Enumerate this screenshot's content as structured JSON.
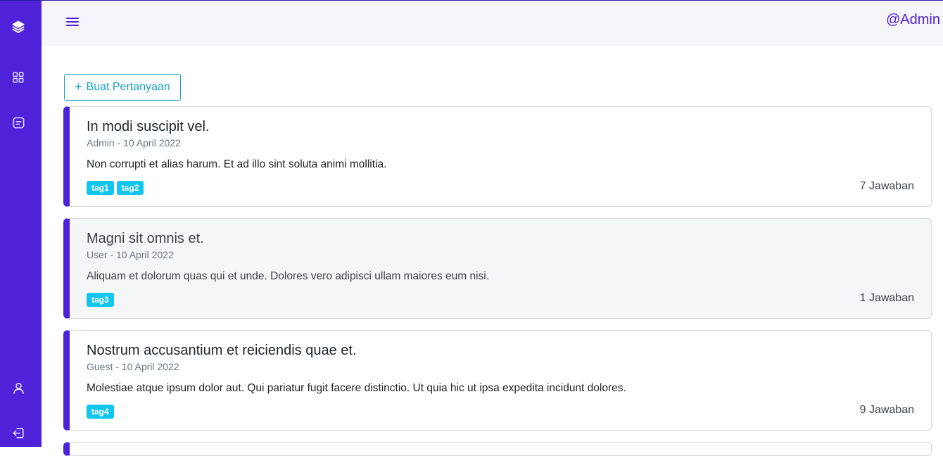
{
  "header": {
    "user_label": "@Admin"
  },
  "sidebar": {
    "items": [
      {
        "icon": "layers-icon"
      },
      {
        "icon": "grid-icon"
      },
      {
        "icon": "document-icon"
      },
      {
        "icon": "user-icon"
      },
      {
        "icon": "logout-icon"
      }
    ]
  },
  "actions": {
    "create_plus": "+",
    "create_label": "Buat Pertanyaan"
  },
  "questions": [
    {
      "title": "In modi suscipit vel.",
      "meta": "Admin - 10 April 2022",
      "body": "Non corrupti et alias harum. Et ad illo sint soluta animi mollitia.",
      "tags": [
        "tag1",
        "tag2"
      ],
      "answers": "7 Jawaban"
    },
    {
      "title": "Magni sit omnis et.",
      "meta": "User - 10 April 2022",
      "body": "Aliquam et dolorum quas qui et unde. Dolores vero adipisci ullam maiores eum nisi.",
      "tags": [
        "tag3"
      ],
      "answers": "1 Jawaban"
    },
    {
      "title": "Nostrum accusantium et reiciendis quae et.",
      "meta": "Guest - 10 April 2022",
      "body": "Molestiae atque ipsum dolor aut. Qui pariatur fugit facere distinctio. Ut quia hic ut ipsa expedita incidunt dolores.",
      "tags": [
        "tag4"
      ],
      "answers": "9 Jawaban"
    }
  ],
  "colors": {
    "primary": "#4d22d8",
    "accent": "#17a2c9",
    "tag": "#11c5ef"
  }
}
